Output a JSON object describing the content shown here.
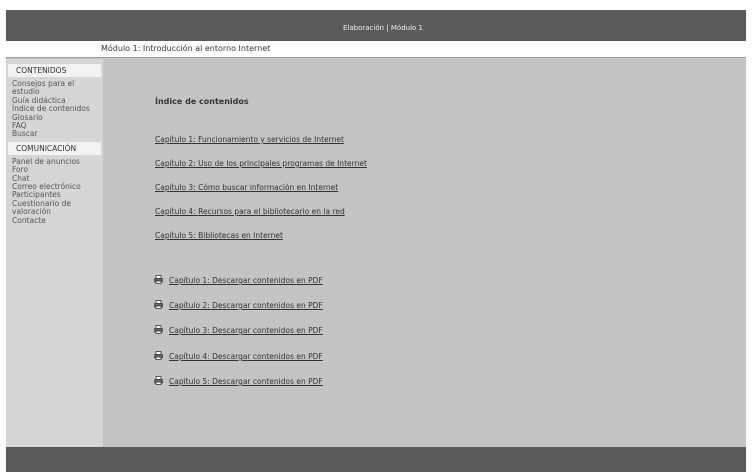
{
  "header": {
    "title": "Elaboración | Módulo 1"
  },
  "module_bar": {
    "label": "Módulo 1: Introducción al entorno Internet"
  },
  "sidebar": {
    "contenidos_heading": "CONTENIDOS",
    "contenidos_items": [
      "Consejos para el estudio",
      "Guía didáctica",
      "Índice de contenidos",
      "Glosario",
      "FAQ",
      "Buscar"
    ],
    "comunicacion_heading": "COMUNICACIÓN",
    "comunicacion_items": [
      "Panel de anuncios",
      "Foro",
      "Chat",
      "Correo electrónico",
      "Participantes",
      "Cuestionario de valoración",
      "Contacte"
    ]
  },
  "main": {
    "title": "Índice de contenidos",
    "chapters": [
      "Capítulo 1: Funcionamiento y servicios de Internet",
      "Capítulo 2: Uso de los principales programas de Internet",
      "Capítulo 3: Cómo buscar información en Internet",
      "Capítulo 4: Recursos para el bibliotecario en la red",
      "Capítulo 5: Bibliotecas en Internet"
    ],
    "pdf_links": [
      "Capítulo 1: Descargar contenidos en PDF",
      "Capítulo 2: Descargar contenidos en PDF",
      "Capítulo 3: Descargar contenidos en PDF",
      "Capítulo 4: Descargar contenidos en PDF",
      "Capítulo 5: Descargar contenidos en PDF"
    ],
    "pdf_icon": "printer-icon"
  },
  "colors": {
    "topbar": "#5a5a5a",
    "background": "#c4c4c4",
    "sidebar": "#d6d6d6"
  }
}
